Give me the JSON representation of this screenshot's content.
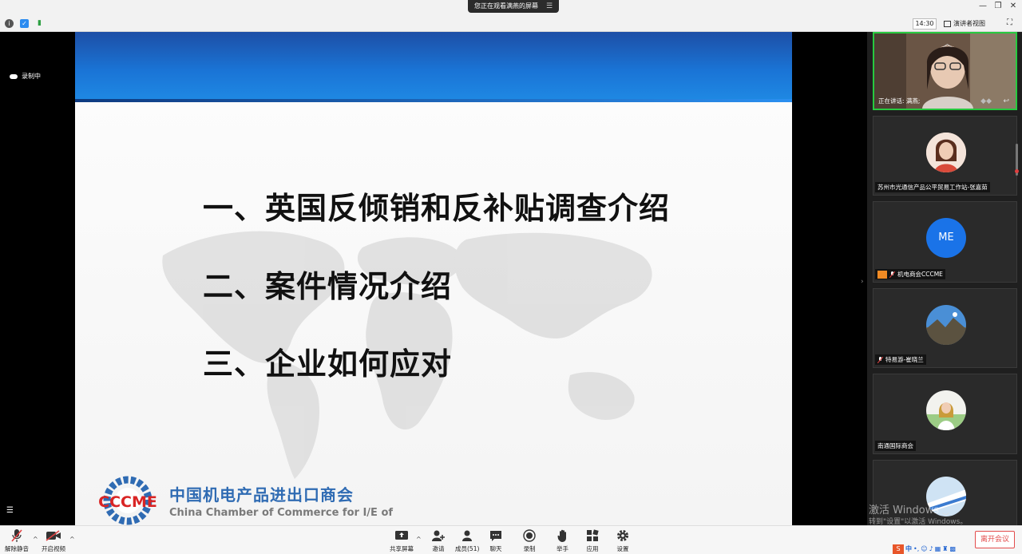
{
  "topbar": {
    "viewing_notice": "您正在观看满燕的屏幕",
    "notice_menu_icon": "settings-sliders-icon",
    "timer": "14:30",
    "view_mode": "演讲者视图"
  },
  "recording": {
    "label": "录制中"
  },
  "slide": {
    "agenda": [
      "一、英国反倾销和反补贴调查介绍",
      "二、案件情况介绍",
      "三、企业如何应对"
    ],
    "logo_mark_text": "CCCME",
    "logo_cn": "中国机电产品进出口商会",
    "logo_en": "China Chamber of Commerce for I/E of"
  },
  "participants": [
    {
      "label": "正在讲话: 满燕;",
      "type": "video"
    },
    {
      "label": "苏州市光通信产品公平贸易工作站-张嘉茹",
      "type": "photo"
    },
    {
      "label": "机电商会CCCME",
      "type": "initials",
      "initials": "ME",
      "host": true
    },
    {
      "label": "特易游-崔晓兰",
      "type": "photo"
    },
    {
      "label": "南通国际商会",
      "type": "photo"
    },
    {
      "label": "",
      "type": "photo"
    }
  ],
  "watermark": {
    "line1": "激活 Windows",
    "line2": "转到\"设置\"以激活 Windows。"
  },
  "toolbar": {
    "unmute": "解除静音",
    "start_video": "开启视频",
    "share": "共享屏幕",
    "invite": "邀请",
    "members": "成员(51)",
    "chat": "聊天",
    "record": "录制",
    "raise_hand": "举手",
    "apps": "应用",
    "settings": "设置",
    "leave": "离开会议"
  },
  "ime": {
    "lang": "中"
  },
  "colors": {
    "speaker_border": "#27c93f",
    "leave_red": "#e34c4c",
    "slide_blue": "#1a74d6",
    "me_blue": "#1a73e8"
  }
}
